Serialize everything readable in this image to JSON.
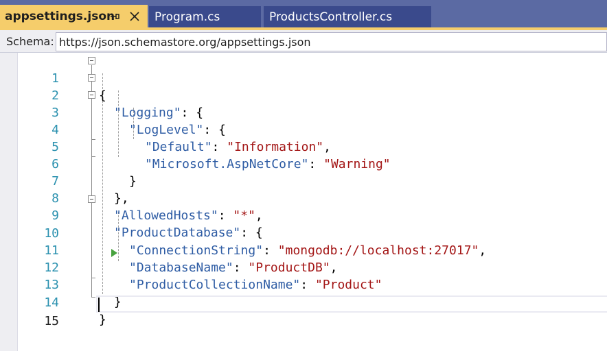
{
  "tabs": [
    {
      "label": "appsettings.json",
      "active": true
    },
    {
      "label": "Program.cs",
      "active": false
    },
    {
      "label": "ProductsController.cs",
      "active": false
    }
  ],
  "schema": {
    "label": "Schema:",
    "value": "https://json.schemastore.org/appsettings.json"
  },
  "editor": {
    "line_numbers": [
      "1",
      "2",
      "3",
      "4",
      "5",
      "6",
      "7",
      "8",
      "9",
      "10",
      "11",
      "12",
      "13",
      "14",
      "15"
    ],
    "current_line": "15",
    "tokens": {
      "l1_brace": "{",
      "l2_key": "\"Logging\"",
      "l2_rest": ": {",
      "l3_key": "\"LogLevel\"",
      "l3_rest": ": {",
      "l4_key": "\"Default\"",
      "l4_colon": ": ",
      "l4_value": "\"Information\"",
      "l4_comma": ",",
      "l5_key": "\"Microsoft.AspNetCore\"",
      "l5_colon": ": ",
      "l5_value": "\"Warning\"",
      "l6_brace": "}",
      "l7_brace": "},",
      "l8_key": "\"AllowedHosts\"",
      "l8_colon": ": ",
      "l8_value": "\"*\"",
      "l8_comma": ",",
      "l9_key": "\"ProductDatabase\"",
      "l9_rest": ": {",
      "l10_key": "\"ConnectionString\"",
      "l10_colon": ": ",
      "l10_value": "\"mongodb://localhost:27017\"",
      "l10_comma": ",",
      "l11_key": "\"DatabaseName\"",
      "l11_colon": ": ",
      "l11_value": "\"ProductDB\"",
      "l11_comma": ",",
      "l12_key": "\"ProductCollectionName\"",
      "l12_colon": ": ",
      "l12_value": "\"Product\"",
      "l13_brace": "}",
      "l14_brace": "}"
    }
  },
  "colors": {
    "tab_active": "#f5cd6b",
    "tab_inactive": "#3a4a8c",
    "tabstrip": "#5b6aa3",
    "json_key": "#2e5ca4",
    "json_string": "#a31515",
    "line_number": "#2b91af"
  },
  "icons": [
    "pin-icon",
    "close-icon",
    "fold-toggle-icon",
    "quick-action-arrow-icon"
  ]
}
